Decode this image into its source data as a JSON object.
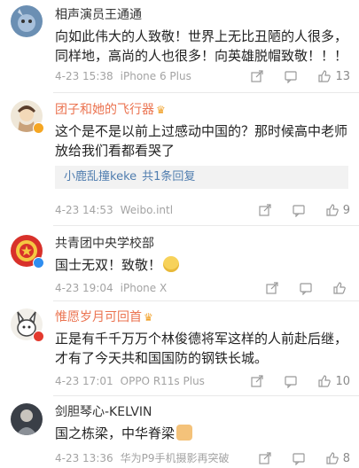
{
  "comments": [
    {
      "user": "相声演员王通通",
      "text": "向如此伟大的人致敬！世界上无比丑陋的人很多，同样地，高尚的人也很多！向英雄脱帽致敬！！！",
      "date": "4-23 15:38",
      "device": "iPhone 6 Plus",
      "likes": "13"
    },
    {
      "user": "团子和她的飞行器",
      "text": "这个是不是以前上过感动中国的？那时候高中老师放给我们看都看哭了",
      "reply_user": "小鹿乱撞keke",
      "reply_more": "共1条回复",
      "date": "4-23 14:53",
      "device": "Weibo.intl",
      "likes": "9"
    },
    {
      "user": "共青团中央学校部",
      "text": "国士无双！致敬！",
      "date": "4-23 19:04",
      "device": "iPhone X",
      "likes": ""
    },
    {
      "user": "惟愿岁月可回首",
      "text": "正是有千千万万个林俊德将军这样的人前赴后继，才有了今天共和国国防的钢铁长城。",
      "date": "4-23 17:01",
      "device": "OPPO R11s Plus",
      "likes": "10"
    },
    {
      "user": "剑胆琴心-KELVIN",
      "text": "国之栋梁，中华脊梁",
      "date": "4-23 13:36",
      "device": "华为P9手机摄影再突破",
      "likes": "8"
    }
  ],
  "icons": {
    "share": "share-icon",
    "comment": "comment-icon",
    "like": "like-icon"
  },
  "colors": {
    "vip_name": "#eb7350",
    "link_blue": "#507daf",
    "meta_gray": "#a3a3a3"
  }
}
